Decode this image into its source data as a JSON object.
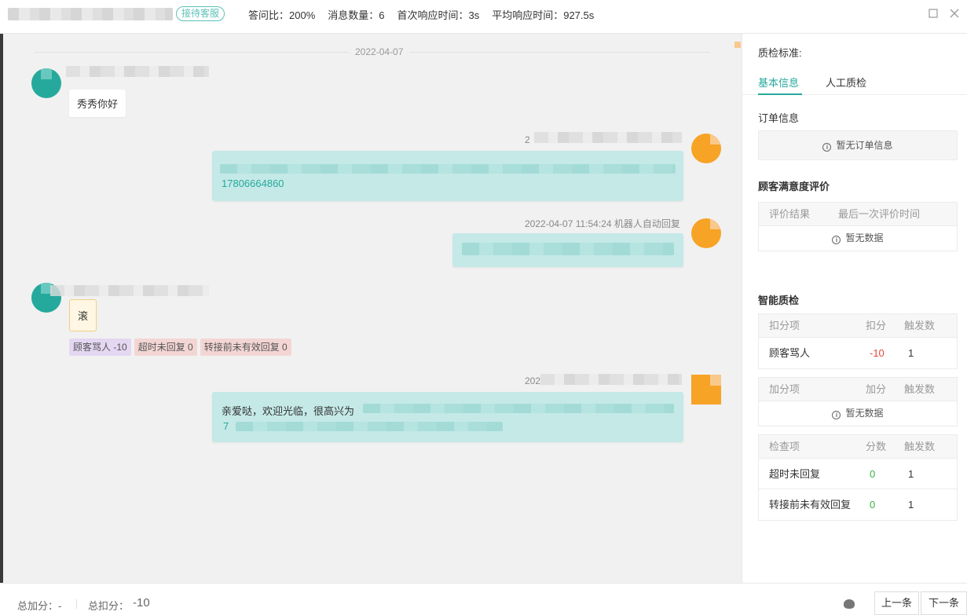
{
  "header": {
    "badge": "接待客服",
    "stats": [
      "答问比：200%",
      "消息数量：6",
      "首次响应时间：3s",
      "平均响应时间：927.5s"
    ]
  },
  "window": {
    "maximize_icon": "square-icon",
    "close_icon": "close-icon"
  },
  "chat": {
    "date": "2022-04-07",
    "messages": [
      {
        "side": "left",
        "text": "秀秀你好"
      },
      {
        "side": "right",
        "meta": "2",
        "phone": "17806664860"
      },
      {
        "side": "right",
        "meta": "2022-04-07 11:54:24   机器人自动回复"
      },
      {
        "side": "left",
        "text": "滚",
        "tags": [
          "顾客骂人 -10",
          "超时未回复 0",
          "转接前未有效回复 0"
        ]
      },
      {
        "side": "right",
        "meta": "202",
        "text": "亲爱哒，欢迎光临，很高兴为",
        "text2": "7"
      }
    ]
  },
  "sidebar": {
    "title": "质检标准:",
    "tabs": [
      "基本信息",
      "人工质检"
    ],
    "order_section": "订单信息",
    "order_empty": "暂无订单信息",
    "rating_section": "顾客满意度评价",
    "rating_headers": [
      "评价结果",
      "最后一次评价时间"
    ],
    "rating_empty": "暂无数据",
    "smart_section": "智能质检",
    "deduct_table": {
      "headers": [
        "扣分项",
        "扣分",
        "触发数"
      ],
      "rows": [
        {
          "item": "顾客骂人",
          "score": "-10",
          "count": "1"
        }
      ]
    },
    "add_table": {
      "headers": [
        "加分项",
        "加分",
        "触发数"
      ],
      "empty": "暂无数据"
    },
    "check_table": {
      "headers": [
        "检查项",
        "分数",
        "触发数"
      ],
      "rows": [
        {
          "item": "超时未回复",
          "score": "0",
          "count": "1"
        },
        {
          "item": "转接前未有效回复",
          "score": "0",
          "count": "1"
        }
      ]
    }
  },
  "footer": {
    "add_label": "总加分：-",
    "deduct_label": "总扣分：",
    "deduct_value": "-10",
    "prev": "上一条",
    "next": "下一条"
  }
}
